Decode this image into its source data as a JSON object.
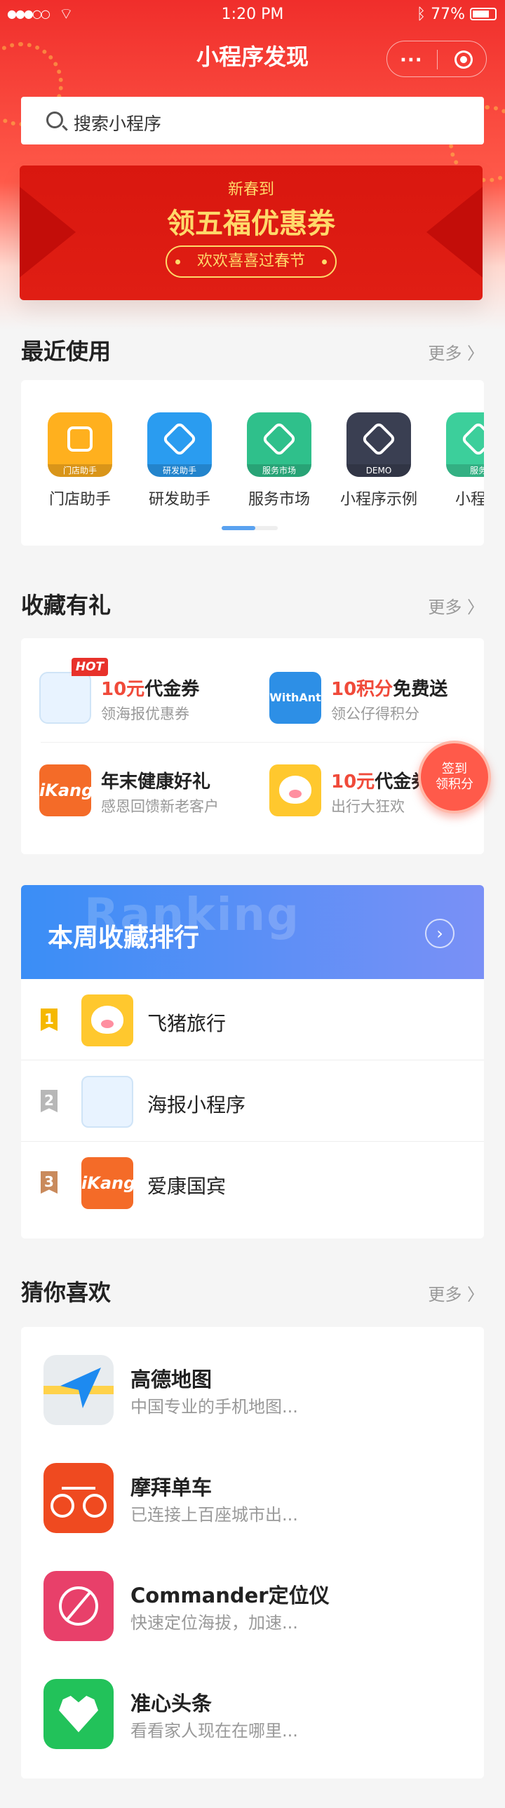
{
  "status_bar": {
    "signal": "●●●○○",
    "time": "1:20 PM",
    "battery": "77%"
  },
  "nav": {
    "title": "小程序发现",
    "more_label": "···"
  },
  "search": {
    "placeholder": "搜索小程序"
  },
  "banner": {
    "line1": "新春到",
    "headline": "领五福优惠券",
    "pill": "欢欢喜喜过春节"
  },
  "recent": {
    "title": "最近使用",
    "more": "更多 〉",
    "items": [
      {
        "label": "门店助手",
        "tag": "门店助手",
        "color": "#ffb01e"
      },
      {
        "label": "研发助手",
        "tag": "研发助手",
        "color": "#2a9cf0"
      },
      {
        "label": "服务市场",
        "tag": "服务市场",
        "color": "#2fc08b"
      },
      {
        "label": "小程序示例",
        "tag": "DEMO",
        "color": "#3a3f52"
      },
      {
        "label": "小程序",
        "tag": "服务",
        "color": "#3ccf9b"
      }
    ]
  },
  "favorites": {
    "title": "收藏有礼",
    "more": "更多 〉",
    "hot": "HOT",
    "items": [
      {
        "highlight": "10元",
        "title": "代金券",
        "sub": "领海报优惠券"
      },
      {
        "highlight": "10积分",
        "title": "免费送",
        "sub": "领公仔得积分",
        "icon_text": "WithAnt"
      },
      {
        "highlight": "",
        "title": "年末健康好礼",
        "sub": "感恩回馈新老客户",
        "icon_text": "iKang"
      },
      {
        "highlight": "10元",
        "title": "代金券",
        "sub": "出行大狂欢"
      }
    ],
    "signin": {
      "line1": "签到",
      "line2": "领积分"
    }
  },
  "ranking": {
    "watermark": "Ranking",
    "title": "本周收藏排行",
    "go": "›",
    "items": [
      {
        "rank": "1",
        "name": "飞猪旅行",
        "color": "#f5b800"
      },
      {
        "rank": "2",
        "name": "海报小程序",
        "color": "#b7b7b7"
      },
      {
        "rank": "3",
        "name": "爱康国宾",
        "color": "#c98a5c",
        "icon_text": "iKang"
      }
    ]
  },
  "guess": {
    "title": "猜你喜欢",
    "more": "更多 〉",
    "items": [
      {
        "name": "高德地图",
        "desc": "中国专业的手机地图..."
      },
      {
        "name": "摩拜单车",
        "desc": "已连接上百座城市出..."
      },
      {
        "name": "Commander定位仪",
        "desc": "快速定位海拔，加速..."
      },
      {
        "name": "准心头条",
        "desc": "看看家人现在在哪里..."
      }
    ]
  }
}
